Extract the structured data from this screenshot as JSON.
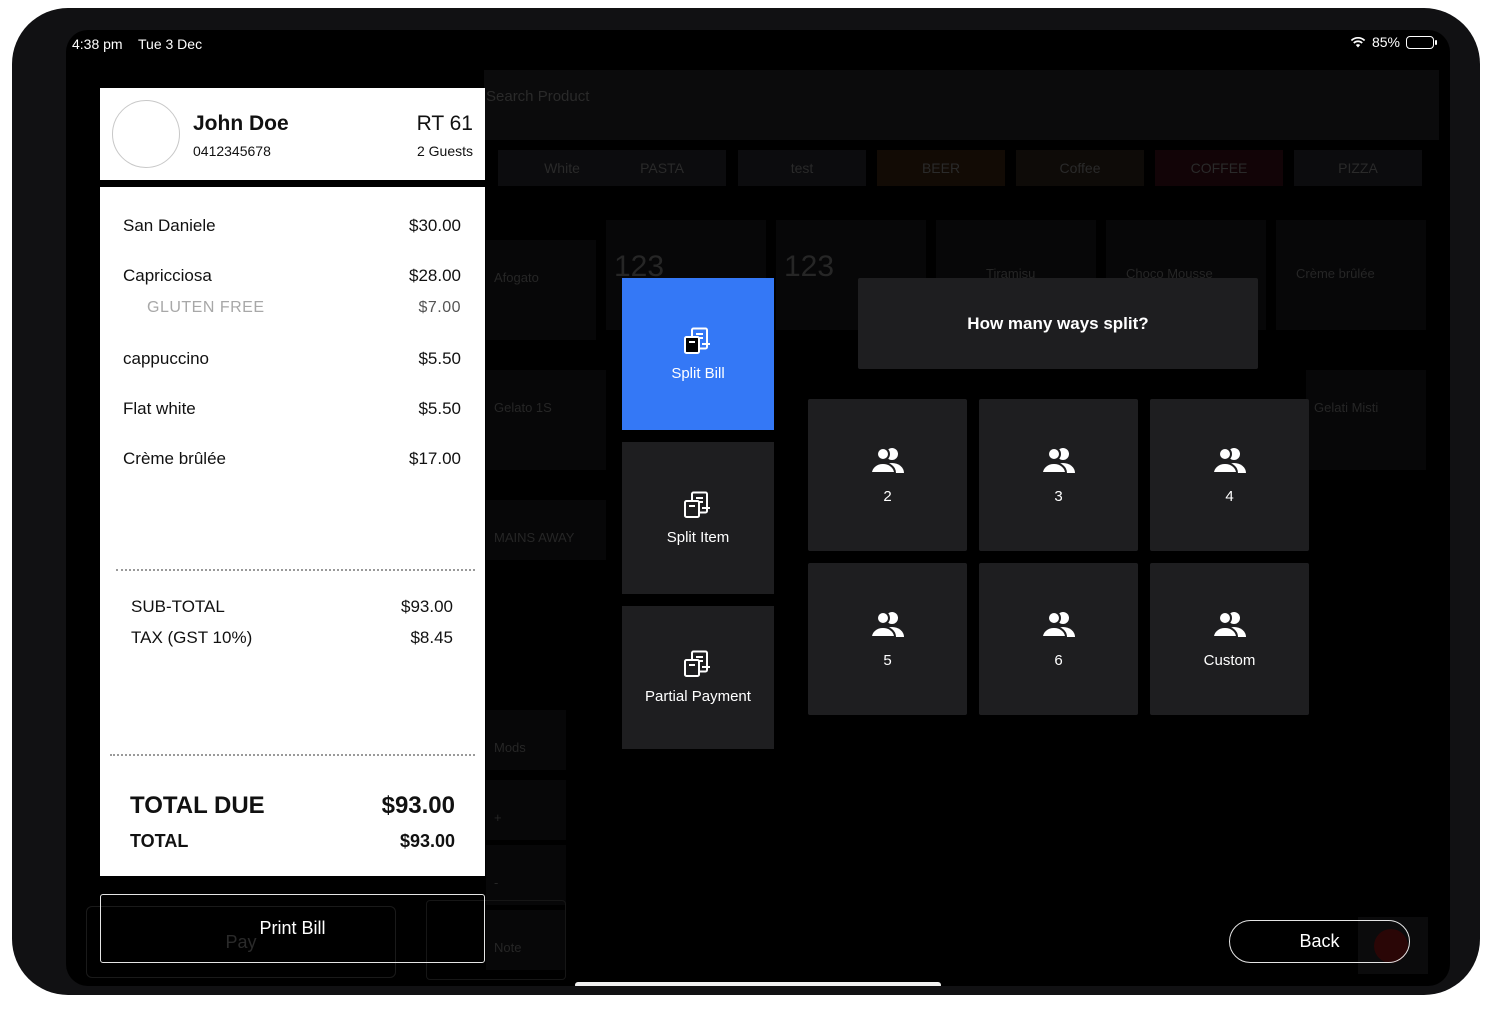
{
  "status_bar": {
    "time": "4:38 pm",
    "date": "Tue 3 Dec",
    "battery_percent": "85%",
    "battery_level": 0.85
  },
  "background": {
    "search_placeholder": "Search Product",
    "categories": [
      "White",
      "PASTA",
      "test",
      "BEER",
      "Coffee",
      "COFFEE",
      "PIZZA"
    ],
    "tiles": [
      "Afogato",
      "123",
      "123",
      "Tiramisu",
      "Choco Mousse",
      "Crème brûlée",
      "Gelato 1S",
      "Gelati Misti",
      "MAINS AWAY",
      "Mods",
      "+",
      "-",
      "Note",
      "Pay"
    ]
  },
  "customer": {
    "name": "John Doe",
    "phone": "0412345678",
    "table": "RT 61",
    "guests": "2 Guests"
  },
  "items": [
    {
      "name": "San Daniele",
      "price": "$30.00"
    },
    {
      "name": "Capricciosa",
      "price": "$28.00"
    },
    {
      "name": "GLUTEN FREE",
      "price": "$7.00"
    },
    {
      "name": "cappuccino",
      "price": "$5.50"
    },
    {
      "name": "Flat white",
      "price": "$5.50"
    },
    {
      "name": "Crème brûlée",
      "price": "$17.00"
    }
  ],
  "summary": {
    "subtotal_label": "SUB-TOTAL",
    "subtotal": "$93.00",
    "tax_label": "TAX (GST 10%)",
    "tax": "$8.45",
    "total_due_label": "TOTAL DUE",
    "total_due": "$93.00",
    "total_label": "TOTAL",
    "total": "$93.00"
  },
  "actions": {
    "print_bill": "Print Bill",
    "back": "Back"
  },
  "split_options": [
    "Split Bill",
    "Split Item",
    "Partial Payment"
  ],
  "split_question": "How many ways split?",
  "split_ways": [
    "2",
    "3",
    "4",
    "5",
    "6",
    "Custom"
  ],
  "colors": {
    "accent": "#3478f6",
    "tile": "#1e1e20",
    "background": "#000000",
    "receipt": "#ffffff"
  }
}
